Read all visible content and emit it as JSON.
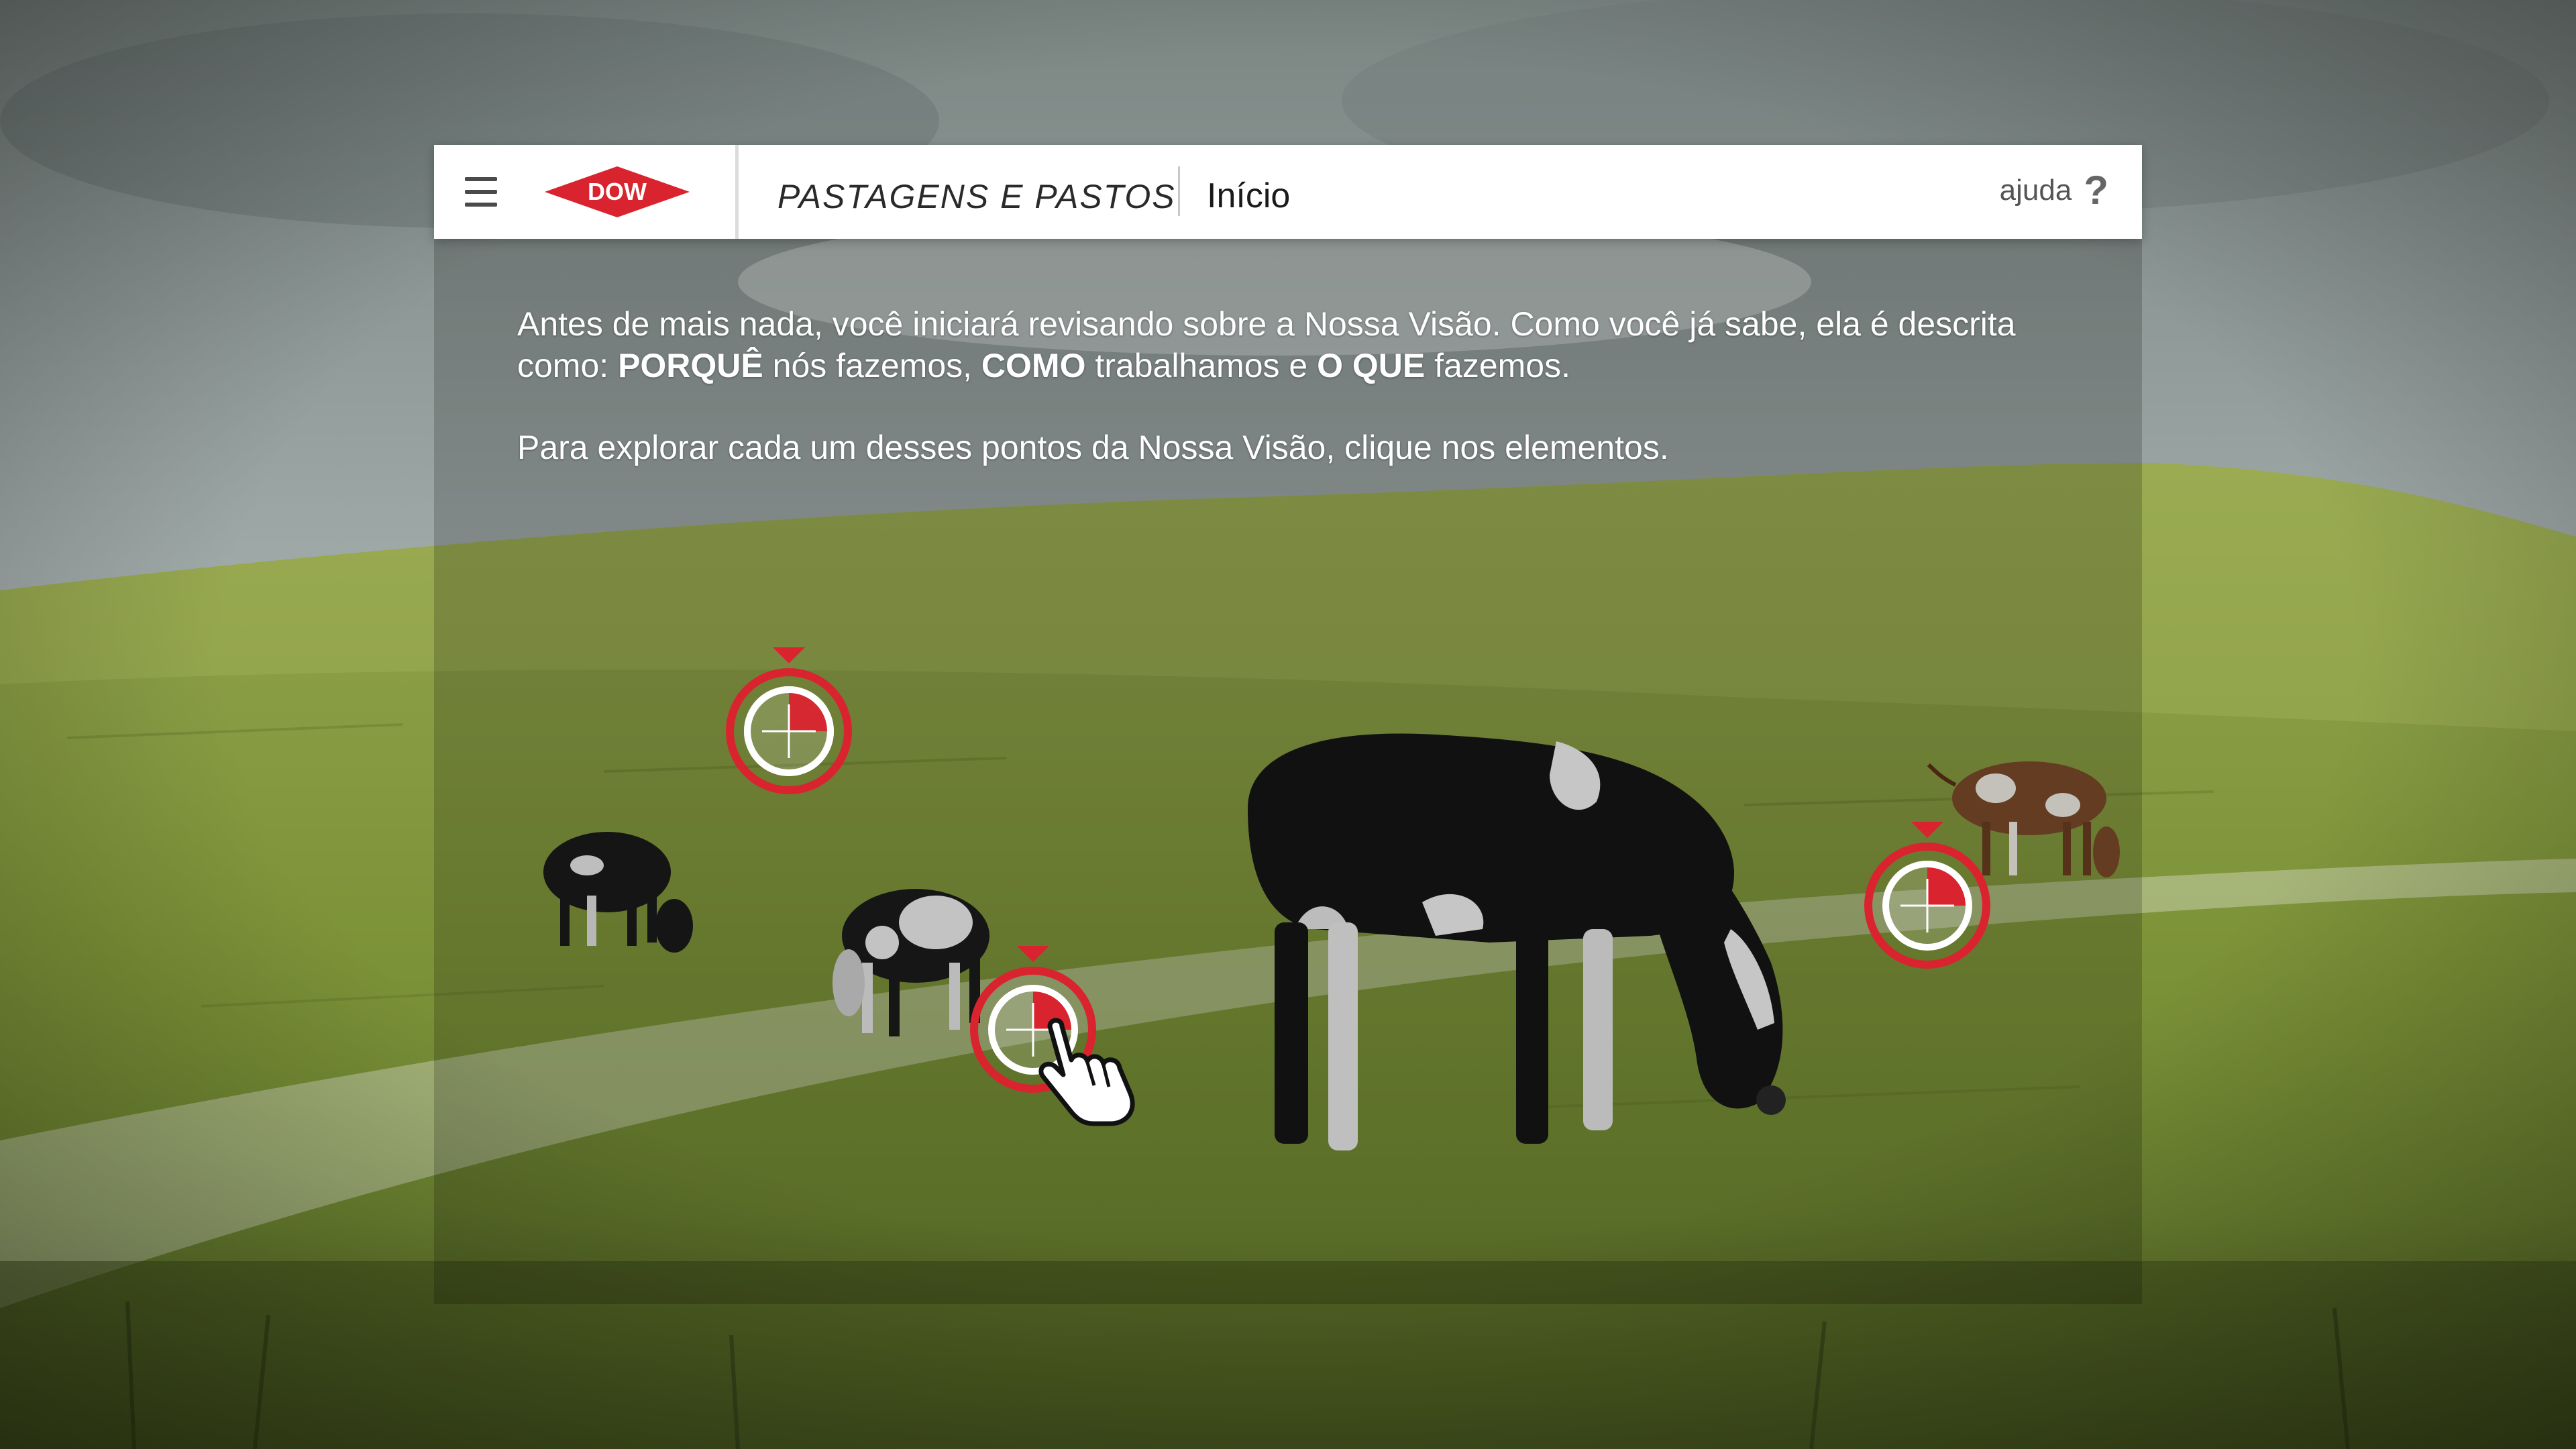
{
  "header": {
    "course_title": "PASTAGENS E PASTOS",
    "page_title": "Início",
    "help_label": "ajuda",
    "help_icon_glyph": "?",
    "logo_text": "DOW"
  },
  "intro": {
    "line1_a": "Antes de mais nada, você iniciará revisando sobre a Nossa Visão. Como você já sabe, ela é descrita",
    "line2_a": "como: ",
    "why": "PORQUÊ",
    "line2_b": " nós fazemos, ",
    "how": "COMO",
    "line2_c": " trabalhamos e ",
    "what": "O QUE",
    "line2_d": " fazemos.",
    "paragraph2": "Para explorar cada um desses pontos da Nossa Visão, clique nos elementos."
  },
  "colors": {
    "accent_red": "#d9232e",
    "header_bg": "#ffffff",
    "text_white": "#ffffff"
  },
  "icons": {
    "menu": "hamburger-icon",
    "help": "question-mark-icon",
    "hotspot": "crosshair-target-icon",
    "cursor": "hand-pointer-icon"
  }
}
